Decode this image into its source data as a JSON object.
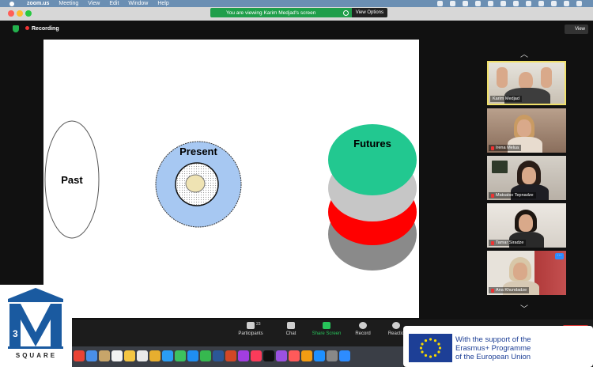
{
  "menubar": {
    "app": "zoom.us",
    "menus": [
      "Meeting",
      "View",
      "Edit",
      "Window",
      "Help"
    ]
  },
  "titlebar": {
    "banner_text": "You are viewing Karim Medjad's screen",
    "view_options": "View Options"
  },
  "meeting": {
    "recording_label": "Recording",
    "view_label": "View"
  },
  "slide": {
    "past": "Past",
    "present": "Present",
    "futures": "Futures"
  },
  "participants": [
    {
      "name": "Karim Medjad",
      "muted": false
    },
    {
      "name": "Irena Melua",
      "muted": true
    },
    {
      "name": "Matsatso Tepnadze",
      "muted": true
    },
    {
      "name": "Tamar Siradze",
      "muted": true
    },
    {
      "name": "Ana Khundadze",
      "muted": true
    }
  ],
  "toolbar": {
    "participants_label": "Participants",
    "participants_count": "23",
    "chat_label": "Chat",
    "share_label": "Share Screen",
    "record_label": "Record",
    "reactions_label": "Reactio"
  },
  "logo": {
    "square_text": "SQUARE"
  },
  "eu": {
    "line1": "With the support of the",
    "line2": "Erasmus+ Programme",
    "line3": "of the European Union"
  },
  "colors": {
    "present_outer": "#a7c8f2",
    "futures_green": "#22c890",
    "futures_gray": "#c6c6c6",
    "futures_red": "#ff0000",
    "futures_dark": "#8a8a8a",
    "share_green": "#27c35a",
    "eu_blue": "#1d3f96"
  }
}
